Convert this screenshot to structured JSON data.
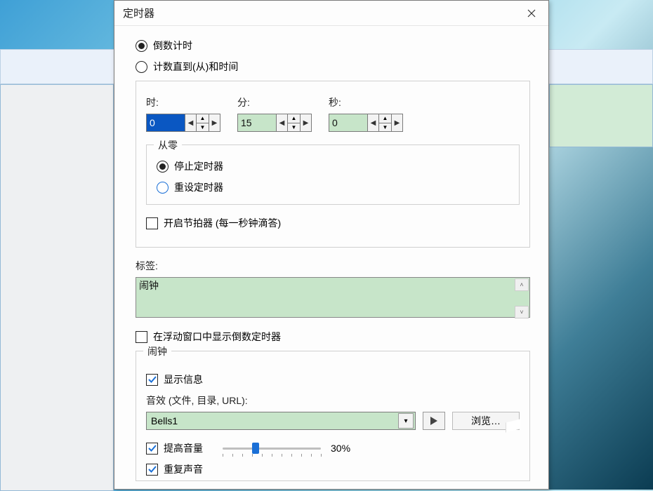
{
  "window": {
    "title": "定时器"
  },
  "mode": {
    "countdown": "倒数计时",
    "countto": "计数直到(从)和时间"
  },
  "time": {
    "hours_label": "时:",
    "hours_value": "0",
    "mins_label": "分:",
    "mins_value": "15",
    "secs_label": "秒:",
    "secs_value": "0"
  },
  "onzero": {
    "legend": "从零",
    "stop": "停止定时器",
    "reset": "重设定时器"
  },
  "metronome": "开启节拍器 (每一秒钟滴答)",
  "label_section": {
    "label": "标签:",
    "value": "闹钟"
  },
  "float_win": "在浮动窗口中显示倒数定时器",
  "alarm": {
    "legend": "闹钟",
    "show_msg": "显示信息",
    "sound_label": "音效 (文件, 目录, URL):",
    "sound_value": "Bells1",
    "browse": "浏览…",
    "boost": "提高音量",
    "boost_pct": "30%",
    "repeat": "重复声音"
  }
}
